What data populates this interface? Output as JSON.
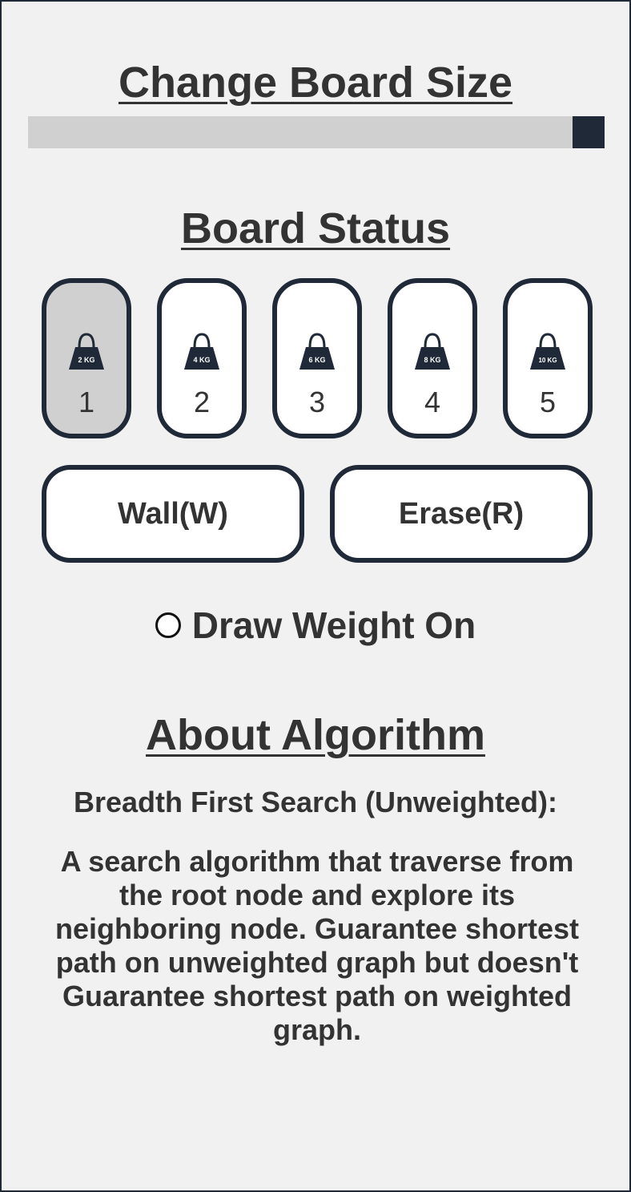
{
  "board_size": {
    "title": "Change Board Size",
    "slider_value_fraction": 1.0
  },
  "board_status": {
    "title": "Board Status",
    "weights": [
      {
        "number": "1",
        "badge": "2 KG",
        "selected": true
      },
      {
        "number": "2",
        "badge": "4 KG",
        "selected": false
      },
      {
        "number": "3",
        "badge": "6 KG",
        "selected": false
      },
      {
        "number": "4",
        "badge": "8 KG",
        "selected": false
      },
      {
        "number": "5",
        "badge": "10 KG",
        "selected": false
      }
    ],
    "wall_label": "Wall(W)",
    "erase_label": "Erase(R)",
    "draw_weight_label": "Draw Weight On",
    "draw_weight_checked": false
  },
  "about": {
    "title": "About Algorithm",
    "algorithm_name": "Breadth First Search (Unweighted):",
    "description": "A search algorithm that traverse from the root node and explore its neighboring node. Guarantee shortest path on unweighted graph but doesn't Guarantee shortest path on weighted graph."
  },
  "colors": {
    "accent": "#1f2937",
    "background": "#f1f1f1",
    "selected_fill": "#d0d0d0",
    "text": "#333333"
  },
  "icons": {
    "weight": "kettlebell-weight-icon",
    "toggle": "radio-circle-icon"
  }
}
